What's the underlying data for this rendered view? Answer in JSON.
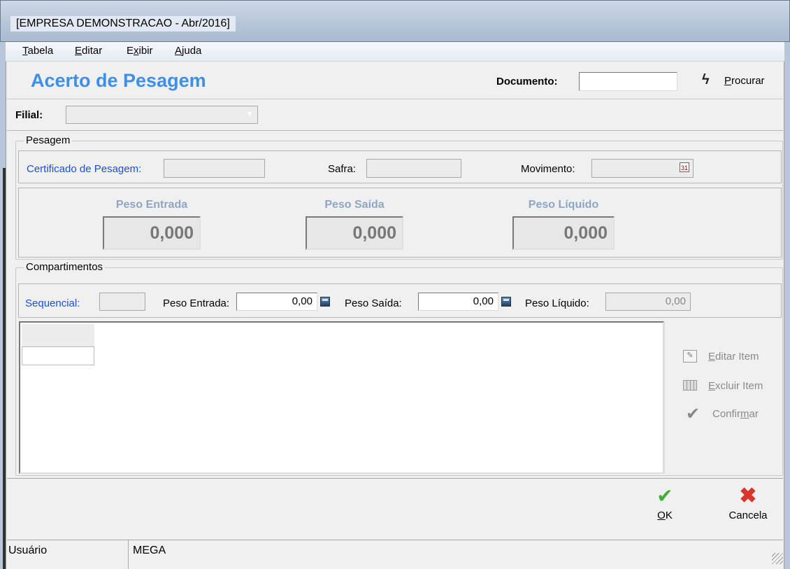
{
  "window": {
    "title": "[EMPRESA DEMONSTRACAO - Abr/2016]"
  },
  "menu": [
    {
      "label": "Tabela",
      "accel": "T",
      "rest": "abela"
    },
    {
      "label": "Editar",
      "accel": "E",
      "rest": "ditar"
    },
    {
      "label": "Exibir",
      "pre": "E",
      "accel": "x",
      "rest": "ibir"
    },
    {
      "label": "Ajuda",
      "accel": "A",
      "rest": "juda"
    }
  ],
  "header": {
    "title": "Acerto de Pesagem",
    "documento_label": "Documento:",
    "documento_value": "",
    "procurar_label": "Procurar",
    "procurar_accel": "P",
    "procurar_rest": "rocurar"
  },
  "filial": {
    "label": "Filial:",
    "value": ""
  },
  "pesagem": {
    "legend": "Pesagem",
    "certificado_label": "Certificado de Pesagem:",
    "certificado_value": "",
    "safra_label": "Safra:",
    "safra_value": "",
    "movimento_label": "Movimento:",
    "movimento_value": "",
    "peso_entrada_label": "Peso Entrada",
    "peso_entrada_value": "0,000",
    "peso_saida_label": "Peso Saída",
    "peso_saida_value": "0,000",
    "peso_liquido_label": "Peso Líquido",
    "peso_liquido_value": "0,000"
  },
  "compartimentos": {
    "legend": "Compartimentos",
    "sequencial_label": "Sequencial:",
    "sequencial_value": "",
    "peso_entrada_label": "Peso Entrada:",
    "peso_entrada_value": "0,00",
    "peso_saida_label": "Peso Saída:",
    "peso_saida_value": "0,00",
    "peso_liquido_label": "Peso Líquido:",
    "peso_liquido_value": "0,00",
    "editar_item": "Editar Item",
    "editar_item_accel": "E",
    "editar_item_rest": "ditar Item",
    "excluir_item": "Excluir Item",
    "excluir_item_accel": "E",
    "excluir_item_rest": "xcluir Item",
    "confirmar": "Confirmar",
    "confirmar_pre": "Confir",
    "confirmar_accel": "m",
    "confirmar_rest": "ar"
  },
  "footer": {
    "ok_label": "OK",
    "ok_accel": "O",
    "ok_rest": "K",
    "cancela_label": "Cancela"
  },
  "status": {
    "user_label": "Usuário",
    "user_value": "MEGA"
  },
  "colors": {
    "title_blue": "#3d8fe8",
    "link_blue": "#1a4fd6",
    "ok_green": "#3cb034",
    "cancel_red": "#d9362b"
  }
}
